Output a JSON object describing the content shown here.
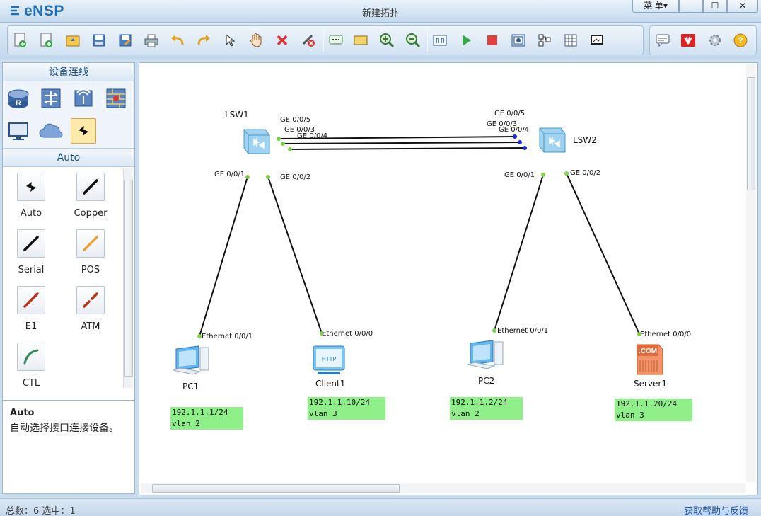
{
  "app": {
    "logo": "eNSP",
    "title": "新建拓扑"
  },
  "window": {
    "menu_label": "菜 单▾",
    "minimize": "—",
    "maximize": "☐",
    "close": "✕"
  },
  "toolbar": {
    "items": [
      "new-topology",
      "new-example",
      "open",
      "save",
      "save-as",
      "print",
      "undo",
      "redo",
      "select",
      "pan",
      "delete",
      "delete-link",
      "text",
      "rectangle",
      "zoom-in",
      "zoom-out",
      "fit",
      "start",
      "stop",
      "capture",
      "tile",
      "topology-grid",
      "screen"
    ],
    "right_items": [
      "chat",
      "huawei",
      "settings",
      "help"
    ]
  },
  "left_panel": {
    "header": "设备连线",
    "categories": [
      "router",
      "switch",
      "wireless",
      "firewall",
      "pc",
      "cloud",
      "auto-cable"
    ],
    "subheader": "Auto",
    "cables": [
      {
        "name": "Auto",
        "color": "#111111"
      },
      {
        "name": "Copper",
        "color": "#111111"
      },
      {
        "name": "Serial",
        "color": "#111111"
      },
      {
        "name": "POS",
        "color": "#f0a030"
      },
      {
        "name": "E1",
        "color": "#c0301a"
      },
      {
        "name": "ATM",
        "color": "#c0301a"
      },
      {
        "name": "CTL",
        "color": "#2e8b57"
      }
    ],
    "description": {
      "title": "Auto",
      "text": "自动选择接口连接设备。"
    }
  },
  "topology": {
    "devices": [
      {
        "id": "LSW1",
        "label": "LSW1",
        "type": "switch"
      },
      {
        "id": "LSW2",
        "label": "LSW2",
        "type": "switch"
      },
      {
        "id": "PC1",
        "label": "PC1",
        "type": "pc"
      },
      {
        "id": "Client1",
        "label": "Client1",
        "type": "client"
      },
      {
        "id": "PC2",
        "label": "PC2",
        "type": "pc"
      },
      {
        "id": "Server1",
        "label": "Server1",
        "type": "server"
      }
    ],
    "ports": {
      "lsw1_p5": "GE 0/0/5",
      "lsw1_p3": "GE 0/0/3",
      "lsw1_p4": "GE 0/0/4",
      "lsw1_p1": "GE 0/0/1",
      "lsw1_p2": "GE 0/0/2",
      "lsw2_p5": "GE 0/0/5",
      "lsw2_p3": "GE 0/0/3",
      "lsw2_p4": "GE 0/0/4",
      "lsw2_p1": "GE 0/0/1",
      "lsw2_p2": "GE 0/0/2",
      "pc1_eth": "Ethernet 0/0/1",
      "client1_eth": "Ethernet 0/0/0",
      "pc2_eth": "Ethernet 0/0/1",
      "server1_eth": "Ethernet 0/0/0"
    },
    "notes": [
      {
        "ip": "192.1.1.1/24",
        "vlan": "vlan 2"
      },
      {
        "ip": "192.1.1.10/24",
        "vlan": "vlan 3"
      },
      {
        "ip": "192.1.1.2/24",
        "vlan": "vlan 2"
      },
      {
        "ip": "192.1.1.20/24",
        "vlan": "vlan 3"
      }
    ],
    "note_color": "#8ff08a"
  },
  "status": {
    "summary": "总数：6  选中：1",
    "help_link": "获取帮助与反馈"
  }
}
